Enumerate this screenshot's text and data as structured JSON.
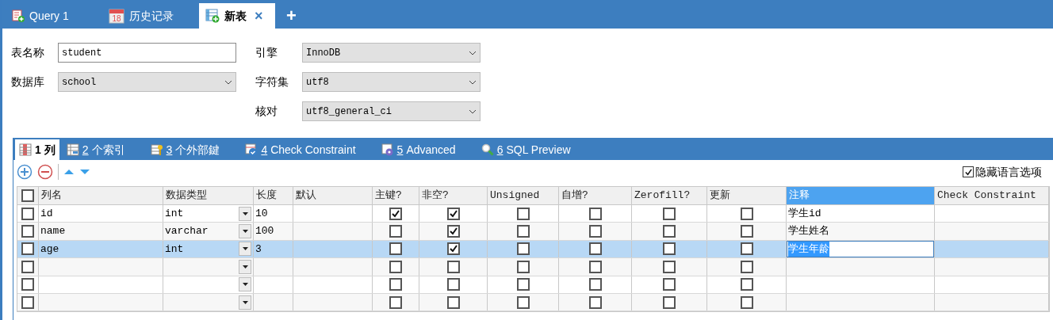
{
  "tabs": [
    {
      "kind": "query",
      "label": "Query 1",
      "selected": false
    },
    {
      "kind": "history",
      "label": "历史记录",
      "calendar_day": "18",
      "selected": false
    },
    {
      "kind": "table",
      "label": "新表",
      "close": "×",
      "selected": true
    }
  ],
  "new_tab": "+",
  "form": {
    "left": [
      {
        "kind": "text",
        "label": "表名称",
        "value": "student"
      },
      {
        "kind": "select",
        "label": "数据库",
        "value": "school"
      }
    ],
    "right": [
      {
        "kind": "select",
        "label": "引擎",
        "value": "InnoDB"
      },
      {
        "kind": "select",
        "label": "字符集",
        "value": "utf8"
      },
      {
        "kind": "select",
        "label": "核对",
        "value": "utf8_general_ci"
      }
    ]
  },
  "subtabs": [
    {
      "kind": "columns",
      "number": "1",
      "label": "列",
      "selected": true
    },
    {
      "kind": "indexes",
      "number": "2",
      "label": "个索引",
      "selected": false
    },
    {
      "kind": "foreign",
      "number": "3",
      "label": "个外部鍵",
      "selected": false
    },
    {
      "kind": "check",
      "number": "4",
      "label": "Check Constraint",
      "selected": false
    },
    {
      "kind": "advanced",
      "number": "5",
      "label": "Advanced",
      "selected": false
    },
    {
      "kind": "sql",
      "number": "6",
      "label": "SQL Preview",
      "selected": false
    }
  ],
  "hide_language": {
    "label": "隐藏语言选项",
    "checked": true
  },
  "table": {
    "header_checked": false,
    "columns": [
      {
        "kind": "text",
        "label": "列名",
        "selected": false
      },
      {
        "kind": "type",
        "label": "数据类型",
        "selected": false
      },
      {
        "kind": "text",
        "label": "长度",
        "selected": false
      },
      {
        "kind": "text",
        "label": "默认",
        "selected": false
      },
      {
        "kind": "check",
        "label": "主键?",
        "selected": false
      },
      {
        "kind": "check",
        "label": "非空?",
        "selected": false
      },
      {
        "kind": "check",
        "label": "Unsigned",
        "selected": false
      },
      {
        "kind": "check",
        "label": "自增?",
        "selected": false
      },
      {
        "kind": "check",
        "label": "Zerofill?",
        "selected": false
      },
      {
        "kind": "check",
        "label": "更新",
        "selected": false
      },
      {
        "kind": "text",
        "label": "注释",
        "selected": true
      },
      {
        "kind": "text",
        "label": "Check Constraint",
        "selected": false
      }
    ],
    "rows": [
      {
        "checked": false,
        "selected": false,
        "cells": [
          {
            "text": "id"
          },
          {
            "text": "int"
          },
          {
            "text": "10"
          },
          {},
          {
            "checked": true
          },
          {
            "checked": true
          },
          {
            "checked": false
          },
          {
            "checked": false
          },
          {
            "checked": false
          },
          {
            "checked": false
          },
          {
            "text": "学生id",
            "editing": false
          },
          {}
        ]
      },
      {
        "checked": false,
        "selected": false,
        "cells": [
          {
            "text": "name"
          },
          {
            "text": "varchar"
          },
          {
            "text": "100"
          },
          {},
          {
            "checked": false
          },
          {
            "checked": true
          },
          {
            "checked": false
          },
          {
            "checked": false
          },
          {
            "checked": false
          },
          {
            "checked": false
          },
          {
            "text": "学生姓名",
            "editing": false
          },
          {}
        ]
      },
      {
        "checked": false,
        "selected": true,
        "cells": [
          {
            "text": "age"
          },
          {
            "text": "int"
          },
          {
            "text": "3"
          },
          {},
          {
            "checked": false
          },
          {
            "checked": true
          },
          {
            "checked": false
          },
          {
            "checked": false
          },
          {
            "checked": false
          },
          {
            "checked": false
          },
          {
            "text": "学生年龄",
            "editing": true
          },
          {}
        ]
      },
      {
        "checked": false,
        "selected": false,
        "cells": [
          {},
          {},
          {},
          {},
          {
            "checked": false
          },
          {
            "checked": false
          },
          {
            "checked": false
          },
          {
            "checked": false
          },
          {
            "checked": false
          },
          {
            "checked": false
          },
          {
            "editing": false
          },
          {}
        ]
      },
      {
        "checked": false,
        "selected": false,
        "cells": [
          {},
          {},
          {},
          {},
          {
            "checked": false
          },
          {
            "checked": false
          },
          {
            "checked": false
          },
          {
            "checked": false
          },
          {
            "checked": false
          },
          {
            "checked": false
          },
          {
            "editing": false
          },
          {}
        ]
      },
      {
        "checked": false,
        "selected": false,
        "cells": [
          {},
          {},
          {},
          {},
          {
            "checked": false
          },
          {
            "checked": false
          },
          {
            "checked": false
          },
          {
            "checked": false
          },
          {
            "checked": false
          },
          {
            "checked": false
          },
          {
            "editing": false
          },
          {}
        ]
      }
    ]
  }
}
